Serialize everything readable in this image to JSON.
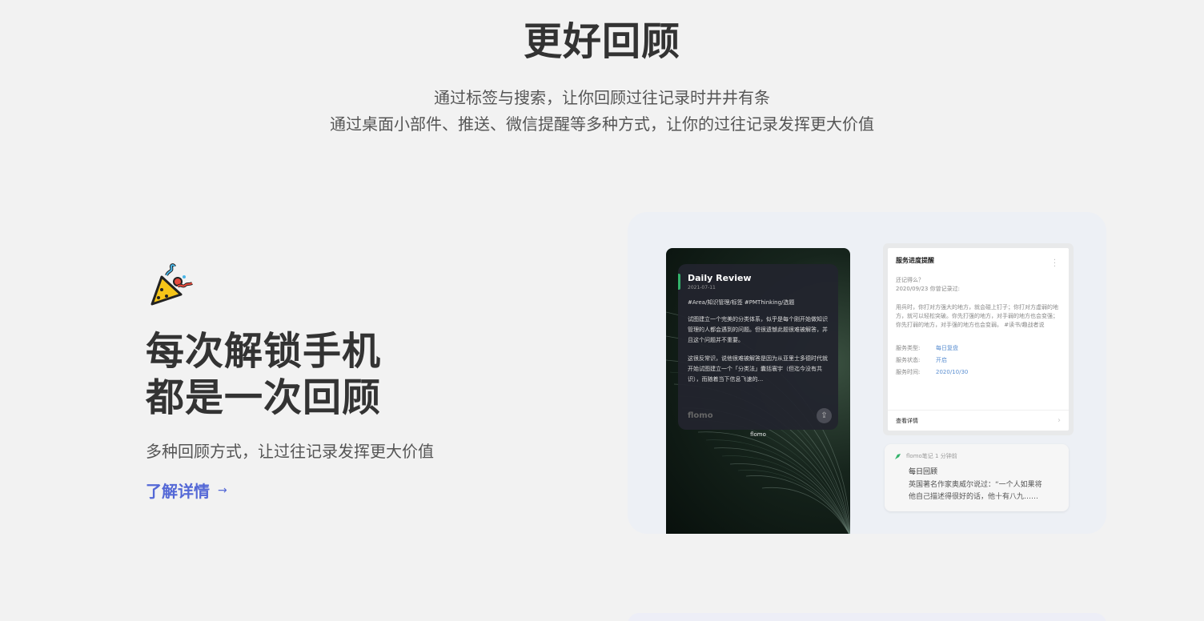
{
  "hero": {
    "title": "更好回顾",
    "subtitle_line1": "通过标签与搜索，让你回顾过往记录时井井有条",
    "subtitle_line2": "通过桌面小部件、推送、微信提醒等多种方式，让你的过往记录发挥更大价值"
  },
  "feature": {
    "icon": "party-popper-icon",
    "title_line1": "每次解锁手机",
    "title_line2": "都是一次回顾",
    "subtitle": "多种回顾方式，让过往记录发挥更大价值",
    "link_label": "了解详情",
    "link_arrow": "→",
    "link_color": "#5468d6"
  },
  "phone_widget": {
    "card_title": "Daily Review",
    "date": "2021-07-11",
    "tags": "#Area/知识管理/标签 #PMThinking/选题",
    "para1": "试图建立一个完美的分类体系，似乎是每个刚开始做知识管理的人都会遇到的问题。但很遗憾此题很难被解答，并且这个问题并不重要。",
    "para2": "这很反常识，说他很难被解答是因为从亚里士多德时代就开始试图建立一个「分类法」囊括寰宇（但迄今没有共识），而随着当下信息飞速的...",
    "card_logo": "flomo",
    "caption": "flomo",
    "accent": "#33b36b"
  },
  "service_card": {
    "title": "服务进度提醒",
    "question": "还记得么？",
    "recorded": "2020/09/23 你曾记录过:",
    "body": "用兵时，你打对方强大的地方，就会碰上钉子；你打对方虚弱的地方，就可以轻松突破。你先打强的地方，对手弱的地方也会变强；你先打弱的地方，对手强的地方也会变弱。 #读书/趣战者说",
    "rows": [
      {
        "key": "服务类型:",
        "value": "每日复盘"
      },
      {
        "key": "服务状态:",
        "value": "开启"
      },
      {
        "key": "服务时间:",
        "value": "2020/10/30"
      }
    ],
    "footer": "查看详情",
    "value_color": "#5b8fd1"
  },
  "notification": {
    "source": "flomo笔记 1 分钟前",
    "title": "每日回顾",
    "body_line1": "英国著名作家奥威尔说过：“一个人如果将",
    "body_line2": "他自己描述得很好的话，他十有八九……"
  }
}
